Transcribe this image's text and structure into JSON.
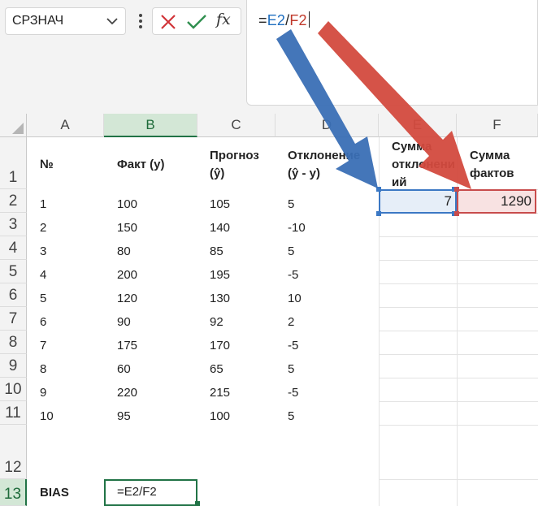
{
  "name_box": {
    "value": "СРЗНАЧ"
  },
  "formula": {
    "prefix": "=",
    "ref1": "E2",
    "op": "/",
    "ref2": "F2"
  },
  "colors": {
    "ref_blue": "#3b78c4",
    "ref_red": "#c84c4c",
    "accent_green": "#217346"
  },
  "columns": [
    "A",
    "B",
    "C",
    "D",
    "E",
    "F"
  ],
  "rows": [
    "1",
    "2",
    "3",
    "4",
    "5",
    "6",
    "7",
    "8",
    "9",
    "10",
    "11",
    "12",
    "13"
  ],
  "headers": {
    "a1": "№",
    "b1": "Факт (y)",
    "c1_line1": "Прогноз",
    "c1_line2": "(ŷ)",
    "d1_line1": "Отклонение",
    "d1_line2": "(ŷ - y)",
    "e1_line1": "Сумма",
    "e1_line2": "отклонени",
    "e1_line3": "ий",
    "f1_line1": "Сумма",
    "f1_line2": "фактов"
  },
  "table": [
    {
      "n": "1",
      "fact": "100",
      "forecast": "105",
      "dev": "5"
    },
    {
      "n": "2",
      "fact": "150",
      "forecast": "140",
      "dev": "-10"
    },
    {
      "n": "3",
      "fact": "80",
      "forecast": "85",
      "dev": "5"
    },
    {
      "n": "4",
      "fact": "200",
      "forecast": "195",
      "dev": "-5"
    },
    {
      "n": "5",
      "fact": "120",
      "forecast": "130",
      "dev": "10"
    },
    {
      "n": "6",
      "fact": "90",
      "forecast": "92",
      "dev": "2"
    },
    {
      "n": "7",
      "fact": "175",
      "forecast": "170",
      "dev": "-5"
    },
    {
      "n": "8",
      "fact": "60",
      "forecast": "65",
      "dev": "5"
    },
    {
      "n": "9",
      "fact": "220",
      "forecast": "215",
      "dev": "-5"
    },
    {
      "n": "10",
      "fact": "95",
      "forecast": "100",
      "dev": "5"
    }
  ],
  "e2": "7",
  "f2": "1290",
  "bias_label": "BIAS",
  "b13_formula": "=E2/F2"
}
